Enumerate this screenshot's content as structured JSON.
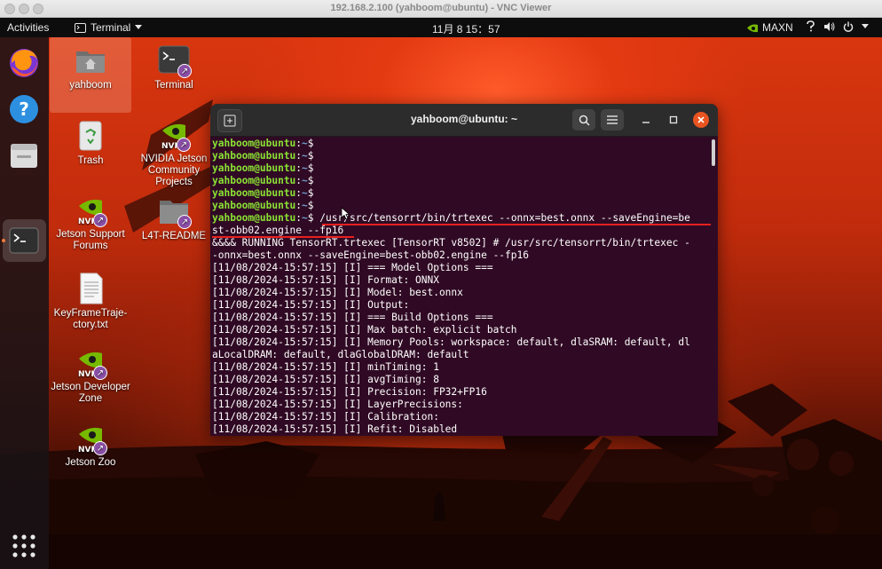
{
  "vnc_window": {
    "title": "192.168.2.100 (yahboom@ubuntu) - VNC Viewer"
  },
  "topbar": {
    "activities": "Activities",
    "app_menu": "Terminal",
    "clock": "11月 8  15：57",
    "power_mode": "MAXN",
    "tray_icons": [
      "help-icon",
      "volume-icon",
      "power-icon",
      "chevron-down-icon"
    ]
  },
  "dock": {
    "items": [
      "firefox-icon",
      "help-icon",
      "files-icon",
      "terminal-icon"
    ],
    "show_apps": "grid-icon"
  },
  "desktop_icons": {
    "yahboom": "yahboom",
    "terminal": "Terminal",
    "trash": "Trash",
    "nvidia_projects": "NVIDIA Jetson Community Projects",
    "jetson_forums": "Jetson Support Forums",
    "l4t_readme": "L4T-README",
    "keyframe": "KeyFrameTraje-ctory.txt",
    "developer_zone": "Jetson Developer Zone",
    "jetson_zoo": "Jetson Zoo"
  },
  "terminal": {
    "title": "yahboom@ubuntu: ~",
    "prompt_user": "yahboom@ubuntu",
    "prompt_sep": ":",
    "prompt_path": "~",
    "prompt_end": "$",
    "command_line_1": " /usr/src/tensorrt/bin/trtexec --onnx=best.onnx --saveEngine=be",
    "command_line_2": "st-obb02.engine --fp16",
    "output": [
      "&&&& RUNNING TensorRT.trtexec [TensorRT v8502] # /usr/src/tensorrt/bin/trtexec -",
      "-onnx=best.onnx --saveEngine=best-obb02.engine --fp16",
      "[11/08/2024-15:57:15] [I] === Model Options ===",
      "[11/08/2024-15:57:15] [I] Format: ONNX",
      "[11/08/2024-15:57:15] [I] Model: best.onnx",
      "[11/08/2024-15:57:15] [I] Output:",
      "[11/08/2024-15:57:15] [I] === Build Options ===",
      "[11/08/2024-15:57:15] [I] Max batch: explicit batch",
      "[11/08/2024-15:57:15] [I] Memory Pools: workspace: default, dlaSRAM: default, dl",
      "aLocalDRAM: default, dlaGlobalDRAM: default",
      "[11/08/2024-15:57:15] [I] minTiming: 1",
      "[11/08/2024-15:57:15] [I] avgTiming: 8",
      "[11/08/2024-15:57:15] [I] Precision: FP32+FP16",
      "[11/08/2024-15:57:15] [I] LayerPrecisions:",
      "[11/08/2024-15:57:15] [I] Calibration:",
      "[11/08/2024-15:57:15] [I] Refit: Disabled"
    ]
  }
}
